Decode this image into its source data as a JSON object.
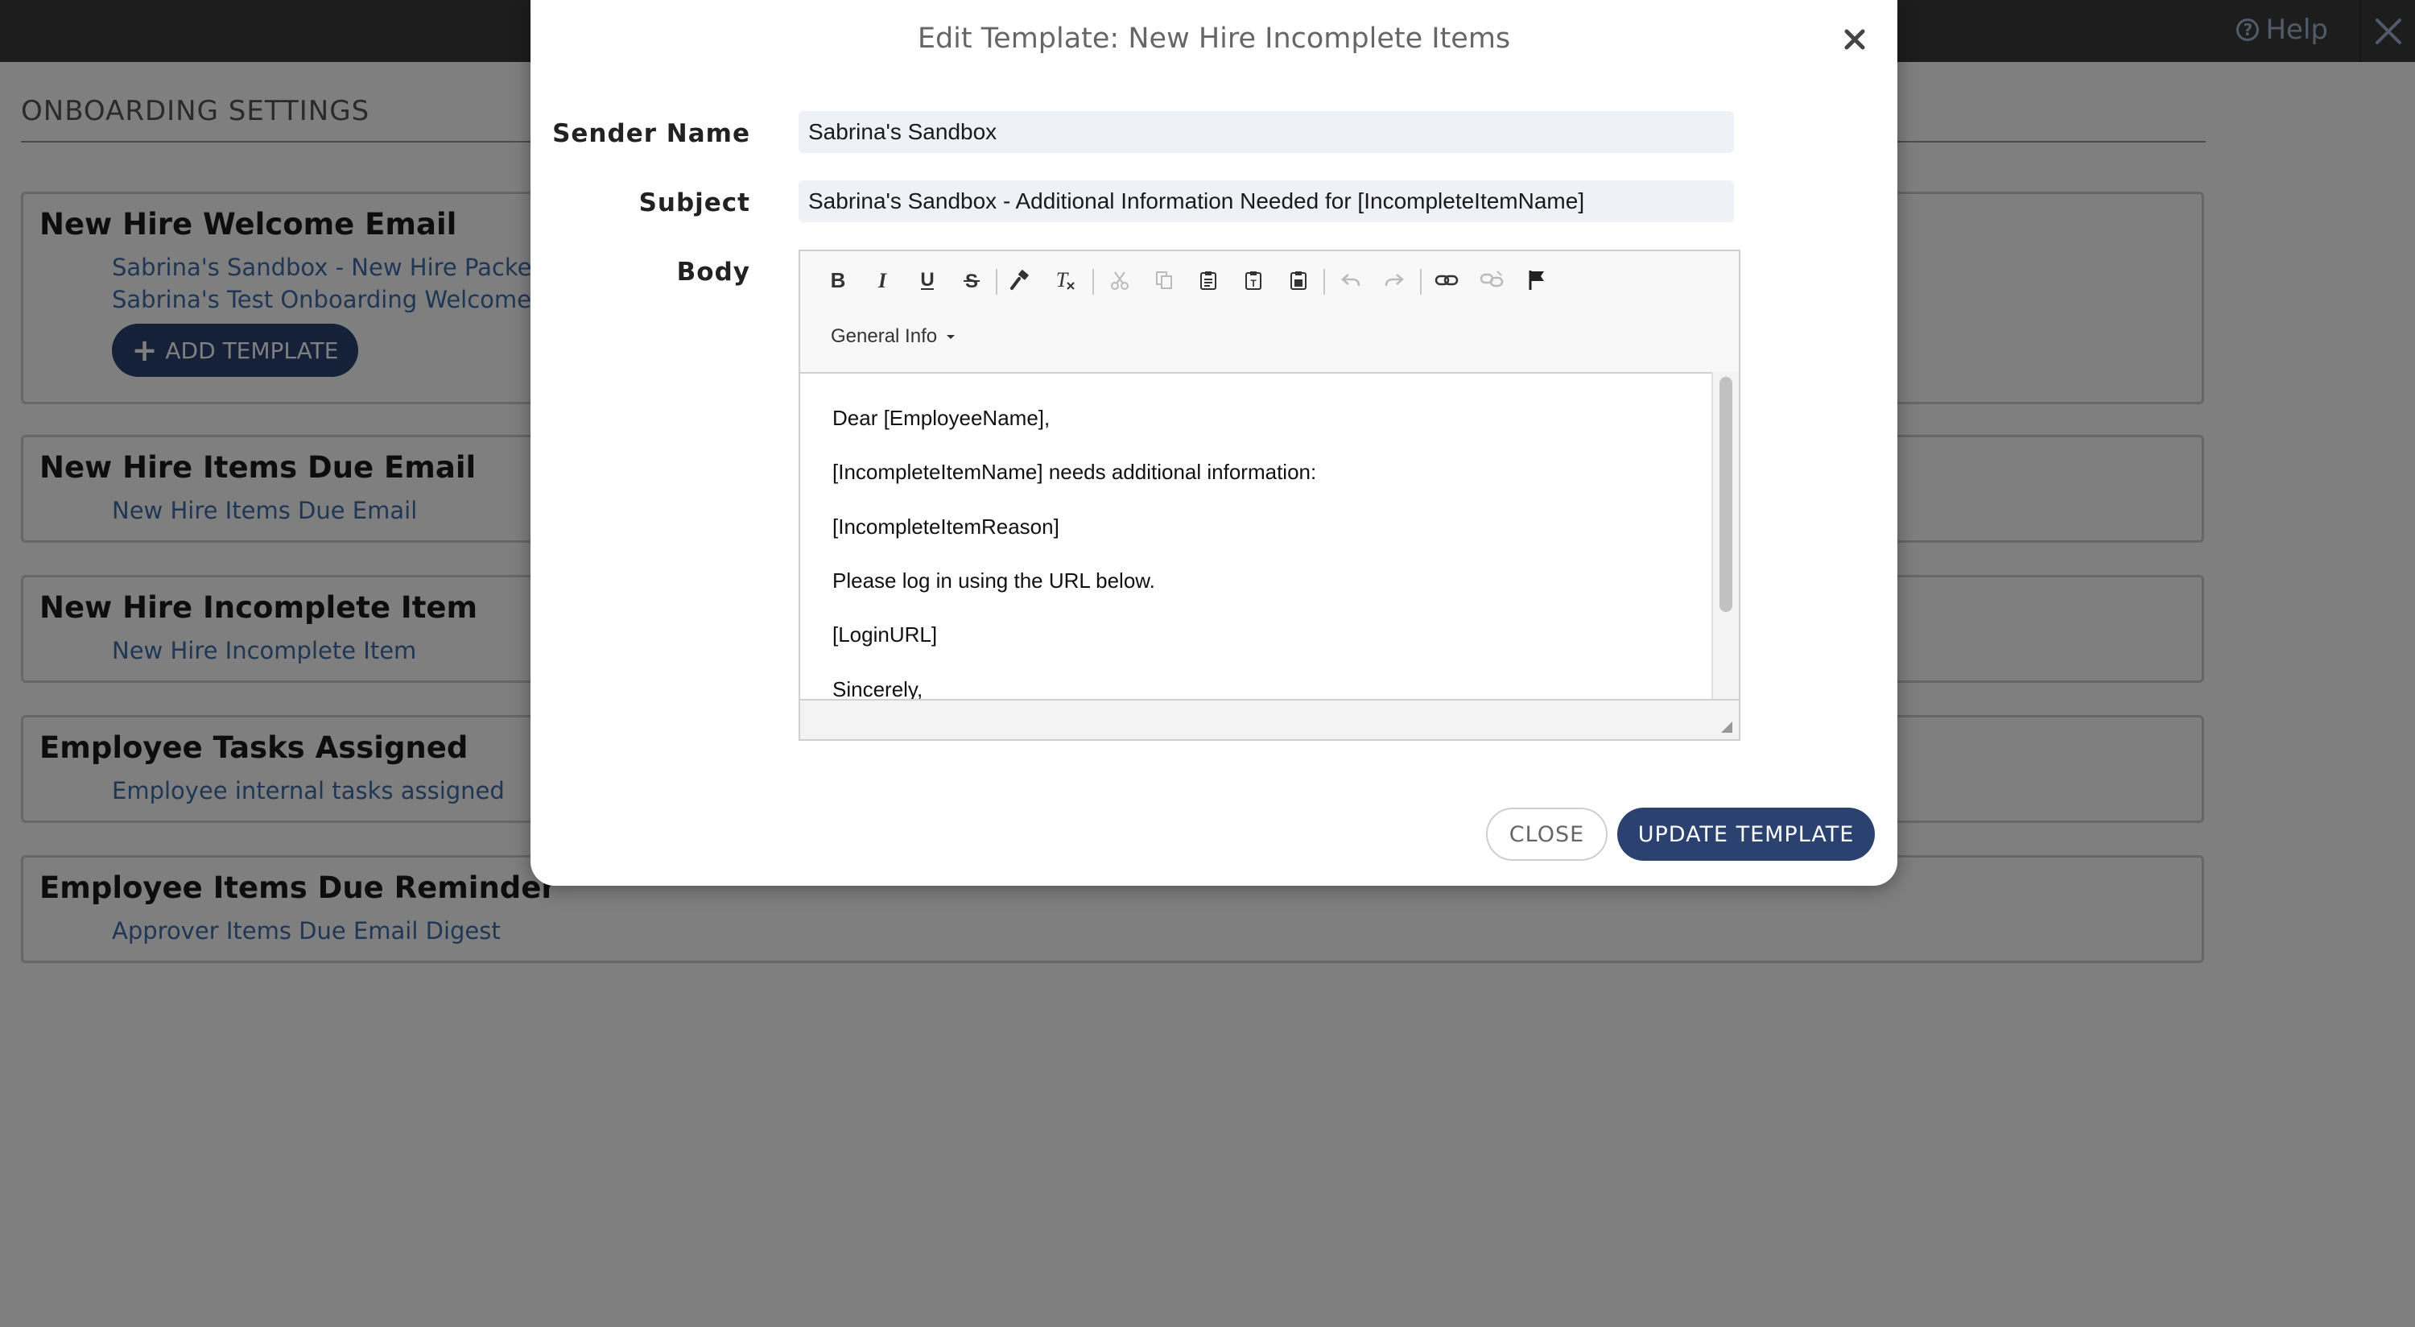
{
  "topbar": {
    "help_label": "Help"
  },
  "settings": {
    "title": "ONBOARDING SETTINGS"
  },
  "cards": [
    {
      "title": "New Hire Welcome Email",
      "links": [
        "Sabrina's Sandbox - New Hire Packet",
        "Sabrina's Test Onboarding Welcome"
      ],
      "add_button": "ADD TEMPLATE"
    },
    {
      "title": "New Hire Items Due Email",
      "links": [
        "New Hire Items Due Email"
      ]
    },
    {
      "title": "New Hire Incomplete Item",
      "links": [
        "New Hire Incomplete Item"
      ]
    },
    {
      "title": "Employee Tasks Assigned",
      "links": [
        "Employee internal tasks assigned"
      ]
    },
    {
      "title": "Employee Items Due Reminder",
      "links": [
        "Approver Items Due Email Digest"
      ]
    }
  ],
  "modal": {
    "title": "Edit Template: New Hire Incomplete Items",
    "sender_name_label": "Sender Name",
    "sender_name_value": "Sabrina's Sandbox",
    "subject_label": "Subject",
    "subject_value": "Sabrina's Sandbox - Additional Information Needed for [IncompleteItemName]",
    "body_label": "Body",
    "editor": {
      "toolbar_icons": [
        "bold-icon",
        "italic-icon",
        "underline-icon",
        "strikethrough-icon",
        "copy-format-icon",
        "remove-format-icon",
        "cut-icon",
        "copy-icon",
        "paste-icon",
        "paste-text-icon",
        "paste-word-icon",
        "undo-icon",
        "redo-icon",
        "link-icon",
        "unlink-icon",
        "anchor-flag-icon"
      ],
      "dropdown_label": "General Info",
      "body_lines": [
        "Dear [EmployeeName],",
        "[IncompleteItemName] needs additional information:",
        "[IncompleteItemReason]",
        "Please log in using the URL below.",
        "[LoginURL]",
        "Sincerely,"
      ]
    },
    "close_button": "CLOSE",
    "update_button": "UPDATE TEMPLATE"
  },
  "colors": {
    "primary": "#2b4270",
    "link": "#3f6ca8",
    "topbar": "#3b3b3b"
  }
}
